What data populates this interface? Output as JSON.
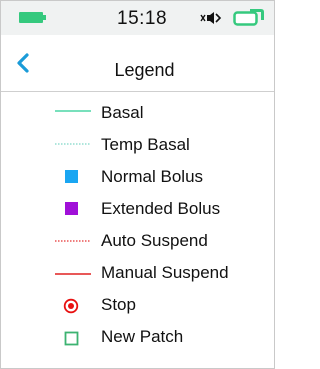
{
  "status_bar": {
    "time": "15:18",
    "icons": [
      "battery-icon",
      "speaker-mute-icon",
      "patch-icon"
    ],
    "accent_color": "#35c97e"
  },
  "header": {
    "back_icon": "chevron-left-icon",
    "title": "Legend",
    "back_color": "#1a9bd8"
  },
  "legend": {
    "items": [
      {
        "label": "Basal",
        "symbol": "solid-line",
        "color": "#4cd6a6"
      },
      {
        "label": "Temp Basal",
        "symbol": "dotted-line",
        "color": "#7dd6c6"
      },
      {
        "label": "Normal Bolus",
        "symbol": "filled-square",
        "color": "#1aa6f2"
      },
      {
        "label": "Extended Bolus",
        "symbol": "filled-square",
        "color": "#a010d8"
      },
      {
        "label": "Auto Suspend",
        "symbol": "dotted-line",
        "color": "#e53030"
      },
      {
        "label": "Manual Suspend",
        "symbol": "solid-line",
        "color": "#e02020"
      },
      {
        "label": "Stop",
        "symbol": "circle-dot",
        "color": "#e81010"
      },
      {
        "label": "New Patch",
        "symbol": "hollow-square",
        "color": "#3cb371"
      }
    ]
  }
}
